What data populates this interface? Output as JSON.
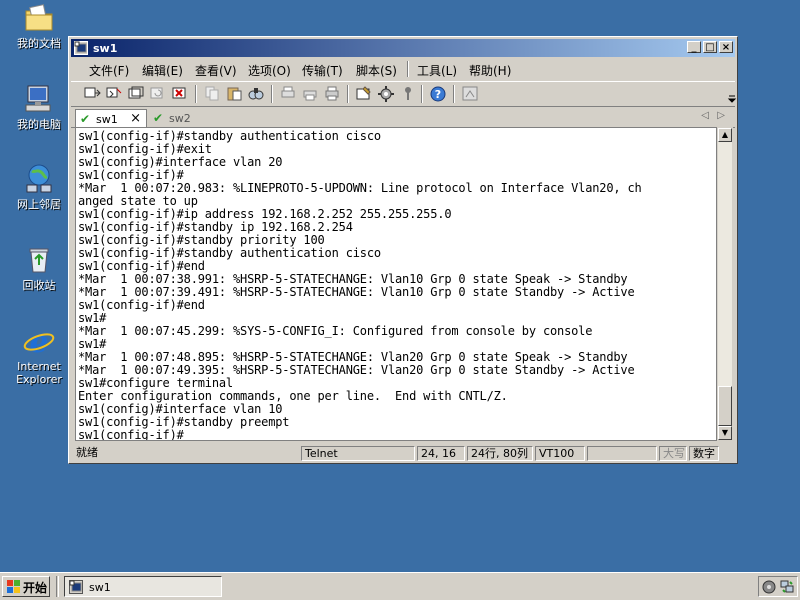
{
  "desktop": {
    "icons": [
      {
        "label": "我的文档",
        "icon": "my-documents-icon"
      },
      {
        "label": "我的电脑",
        "icon": "my-computer-icon"
      },
      {
        "label": "网上邻居",
        "icon": "network-places-icon"
      },
      {
        "label": "回收站",
        "icon": "recycle-bin-icon"
      },
      {
        "label": "Internet Explorer",
        "icon": "internet-explorer-icon"
      }
    ]
  },
  "window": {
    "title": "sw1",
    "controls": {
      "minimize": "_",
      "maximize": "□",
      "close": "×"
    }
  },
  "menu": [
    "文件(F)",
    "编辑(E)",
    "查看(V)",
    "选项(O)",
    "传输(T)",
    "脚本(S)",
    "工具(L)",
    "帮助(H)"
  ],
  "tabs": [
    {
      "label": "sw1",
      "active": true,
      "close": "×"
    },
    {
      "label": "sw2",
      "active": false
    }
  ],
  "terminal": {
    "lines": [
      "sw1(config-if)#standby authentication cisco",
      "sw1(config-if)#exit",
      "sw1(config)#interface vlan 20",
      "sw1(config-if)#",
      "*Mar  1 00:07:20.983: %LINEPROTO-5-UPDOWN: Line protocol on Interface Vlan20, ch",
      "anged state to up",
      "sw1(config-if)#ip address 192.168.2.252 255.255.255.0",
      "sw1(config-if)#standby ip 192.168.2.254",
      "sw1(config-if)#standby priority 100",
      "sw1(config-if)#standby authentication cisco",
      "sw1(config-if)#end",
      "*Mar  1 00:07:38.991: %HSRP-5-STATECHANGE: Vlan10 Grp 0 state Speak -> Standby",
      "*Mar  1 00:07:39.491: %HSRP-5-STATECHANGE: Vlan10 Grp 0 state Standby -> Active",
      "sw1(config-if)#end",
      "sw1#",
      "*Mar  1 00:07:45.299: %SYS-5-CONFIG_I: Configured from console by console",
      "sw1#",
      "*Mar  1 00:07:48.895: %HSRP-5-STATECHANGE: Vlan20 Grp 0 state Speak -> Standby",
      "*Mar  1 00:07:49.395: %HSRP-5-STATECHANGE: Vlan20 Grp 0 state Standby -> Active",
      "sw1#configure terminal",
      "Enter configuration commands, one per line.  End with CNTL/Z.",
      "sw1(config)#interface vlan 10",
      "sw1(config-if)#standby preempt",
      "sw1(config-if)#"
    ]
  },
  "status": {
    "ready": "就绪",
    "protocol": "Telnet",
    "cursor": "24, 16",
    "size": "24行, 80列",
    "emulation": "VT100",
    "caps": "大写",
    "num": "数字"
  },
  "taskbar": {
    "start": "开始",
    "task_label": "sw1"
  },
  "colors": {
    "desktop": "#3a6ea5",
    "title_start": "#0a246a",
    "title_end": "#a6caf0",
    "chrome": "#d4d0c8"
  }
}
